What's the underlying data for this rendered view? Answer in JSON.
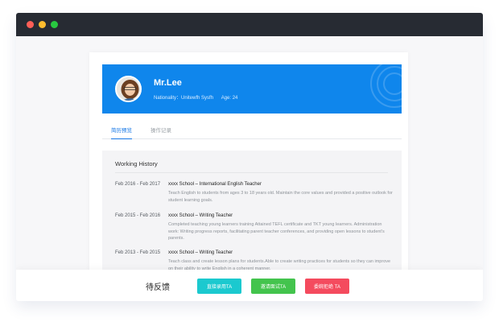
{
  "colors": {
    "titlebar": "#272b33",
    "banner": "#0f86ec",
    "tab_active": "#1677e6",
    "hire_button": "#1bc9cf",
    "interview_button": "#43c44d",
    "reject_button": "#f44b5e"
  },
  "profile": {
    "name": "Mr.Lee",
    "nationality": "Nationality：Unitewfh Sysfh",
    "age": "Age: 24"
  },
  "tabs": [
    {
      "label": "简历预览",
      "active": true
    },
    {
      "label": "操作记录",
      "active": false
    }
  ],
  "working_history": {
    "title": "Working History",
    "entries": [
      {
        "period": "Feb 2016 - Feb 2017",
        "role": "xxxx School – International English Teacher",
        "description": "Teach English to students from ages 3 to 18 years old. Maintain the core values  and provided a positive outlook for student learning goals."
      },
      {
        "period": "Feb 2015 - Feb 2016",
        "role": "xxxx School – Writing Teacher",
        "description": "Completed teaching young learners training Attained TEFL certificate and TKT young learners. Administration work: Writing progress reports, facilitating parent teacher conferences, and providing open lessons to student's parents."
      },
      {
        "period": "Feb 2013 - Feb 2015",
        "role": "xxxx School – Writing Teacher",
        "description": "Teach class and create lesson plans for students.Able to create writing practices for students so they can improve on their ability to write English in a coherent manner."
      }
    ]
  },
  "footer": {
    "status": "待反馈",
    "hire_label": "直接录用TA",
    "interview_label": "邀请面试TA",
    "reject_label": "委婉拒绝 TA"
  }
}
